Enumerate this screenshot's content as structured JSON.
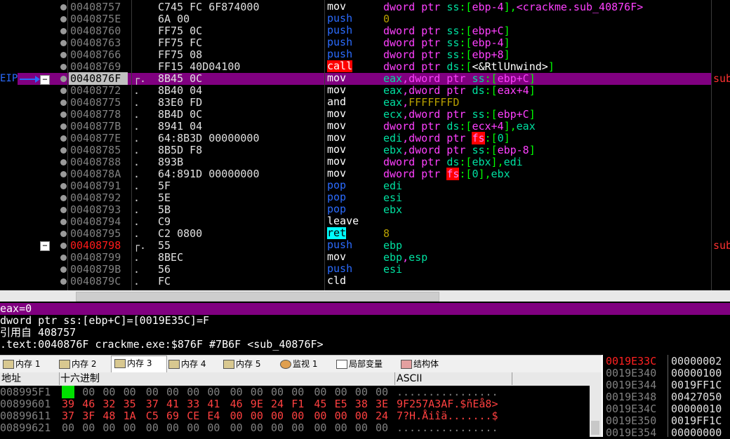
{
  "disassembly": {
    "eip_label": "EIP",
    "fold_symbol": "−",
    "rows": [
      {
        "addr": "00408757",
        "bracket": "",
        "bytes": "C745 FC 6F874000",
        "mnem": "mov",
        "mnem_style": "mov",
        "ops": [
          [
            "dword ptr ",
            "mag"
          ],
          [
            "ss",
            "gr"
          ],
          [
            ":[",
            "lime"
          ],
          [
            "ebp-4",
            "mag"
          ],
          [
            "],",
            "lime"
          ],
          [
            "<crackme.sub_40876F>",
            "mag"
          ]
        ],
        "cmt": ""
      },
      {
        "addr": "0040875E",
        "bracket": "",
        "bytes": "6A 00",
        "mnem": "push",
        "mnem_style": "push",
        "ops": [
          [
            "0",
            "gold"
          ]
        ],
        "cmt": ""
      },
      {
        "addr": "00408760",
        "bracket": "",
        "bytes": "FF75 0C",
        "mnem": "push",
        "mnem_style": "push",
        "ops": [
          [
            "dword ptr ",
            "mag"
          ],
          [
            "ss",
            "gr"
          ],
          [
            ":[",
            "lime"
          ],
          [
            "ebp+C",
            "mag"
          ],
          [
            "]",
            "lime"
          ]
        ],
        "cmt": ""
      },
      {
        "addr": "00408763",
        "bracket": "",
        "bytes": "FF75 FC",
        "mnem": "push",
        "mnem_style": "push",
        "ops": [
          [
            "dword ptr ",
            "mag"
          ],
          [
            "ss",
            "gr"
          ],
          [
            ":[",
            "lime"
          ],
          [
            "ebp-4",
            "mag"
          ],
          [
            "]",
            "lime"
          ]
        ],
        "cmt": ""
      },
      {
        "addr": "00408766",
        "bracket": "",
        "bytes": "FF75 08",
        "mnem": "push",
        "mnem_style": "push",
        "ops": [
          [
            "dword ptr ",
            "mag"
          ],
          [
            "ss",
            "gr"
          ],
          [
            ":[",
            "lime"
          ],
          [
            "ebp+8",
            "mag"
          ],
          [
            "]",
            "lime"
          ]
        ],
        "cmt": ""
      },
      {
        "addr": "00408769",
        "bracket": "",
        "bytes": "FF15 40D04100",
        "mnem": "call",
        "mnem_style": "call",
        "ops": [
          [
            "dword ptr ",
            "mag"
          ],
          [
            "ds",
            "gr"
          ],
          [
            ":[",
            "lime"
          ],
          [
            "<&RtlUnwind>",
            "white"
          ],
          [
            "]",
            "lime"
          ]
        ],
        "cmt": ""
      },
      {
        "addr": "0040876F",
        "bracket": "┌.",
        "bytes": "8B45 0C",
        "mnem": "mov",
        "mnem_style": "mov",
        "ops": [
          [
            "eax",
            "gr"
          ],
          [
            ",",
            "mag"
          ],
          [
            "dword ptr ",
            "mag"
          ],
          [
            "ss",
            "gr"
          ],
          [
            ":[",
            "lime"
          ],
          [
            "ebp+C",
            "mag"
          ],
          [
            "]",
            "lime"
          ]
        ],
        "cmt": "sub",
        "sel": true,
        "eip": true
      },
      {
        "addr": "00408772",
        "bracket": ".",
        "bytes": "8B40 04",
        "mnem": "mov",
        "mnem_style": "mov",
        "ops": [
          [
            "eax",
            "gr"
          ],
          [
            ",",
            "mag"
          ],
          [
            "dword ptr ",
            "mag"
          ],
          [
            "ds",
            "gr"
          ],
          [
            ":[",
            "lime"
          ],
          [
            "eax+4",
            "mag"
          ],
          [
            "]",
            "lime"
          ]
        ],
        "cmt": ""
      },
      {
        "addr": "00408775",
        "bracket": ".",
        "bytes": "83E0 FD",
        "mnem": "and",
        "mnem_style": "mov",
        "ops": [
          [
            "eax",
            "gr"
          ],
          [
            ",",
            "mag"
          ],
          [
            "FFFFFFFD",
            "gold"
          ]
        ],
        "cmt": ""
      },
      {
        "addr": "00408778",
        "bracket": ".",
        "bytes": "8B4D 0C",
        "mnem": "mov",
        "mnem_style": "mov",
        "ops": [
          [
            "ecx",
            "gr"
          ],
          [
            ",",
            "mag"
          ],
          [
            "dword ptr ",
            "mag"
          ],
          [
            "ss",
            "gr"
          ],
          [
            ":[",
            "lime"
          ],
          [
            "ebp+C",
            "mag"
          ],
          [
            "]",
            "lime"
          ]
        ],
        "cmt": ""
      },
      {
        "addr": "0040877B",
        "bracket": ".",
        "bytes": "8941 04",
        "mnem": "mov",
        "mnem_style": "mov",
        "ops": [
          [
            "dword ptr ",
            "mag"
          ],
          [
            "ds",
            "gr"
          ],
          [
            ":[",
            "lime"
          ],
          [
            "ecx+4",
            "mag"
          ],
          [
            "],",
            "lime"
          ],
          [
            "eax",
            "gr"
          ]
        ],
        "cmt": ""
      },
      {
        "addr": "0040877E",
        "bracket": ".",
        "bytes": "64:8B3D 00000000",
        "mnem": "mov",
        "mnem_style": "mov",
        "ops": [
          [
            "edi",
            "gr"
          ],
          [
            ",",
            "mag"
          ],
          [
            "dword ptr ",
            "mag"
          ],
          [
            "fs",
            "fs"
          ],
          [
            ":[",
            "lime"
          ],
          [
            "0",
            "gr"
          ],
          [
            "]",
            "lime"
          ]
        ],
        "cmt": ""
      },
      {
        "addr": "00408785",
        "bracket": ".",
        "bytes": "8B5D F8",
        "mnem": "mov",
        "mnem_style": "mov",
        "ops": [
          [
            "ebx",
            "gr"
          ],
          [
            ",",
            "mag"
          ],
          [
            "dword ptr ",
            "mag"
          ],
          [
            "ss",
            "gr"
          ],
          [
            ":[",
            "lime"
          ],
          [
            "ebp-8",
            "mag"
          ],
          [
            "]",
            "lime"
          ]
        ],
        "cmt": ""
      },
      {
        "addr": "00408788",
        "bracket": ".",
        "bytes": "893B",
        "mnem": "mov",
        "mnem_style": "mov",
        "ops": [
          [
            "dword ptr ",
            "mag"
          ],
          [
            "ds",
            "gr"
          ],
          [
            ":[",
            "lime"
          ],
          [
            "ebx",
            "gr"
          ],
          [
            "],",
            "lime"
          ],
          [
            "edi",
            "gr"
          ]
        ],
        "cmt": ""
      },
      {
        "addr": "0040878A",
        "bracket": ".",
        "bytes": "64:891D 00000000",
        "mnem": "mov",
        "mnem_style": "mov",
        "ops": [
          [
            "dword ptr ",
            "mag"
          ],
          [
            "fs",
            "fs"
          ],
          [
            ":[",
            "lime"
          ],
          [
            "0",
            "gr"
          ],
          [
            "],",
            "lime"
          ],
          [
            "ebx",
            "gr"
          ]
        ],
        "cmt": ""
      },
      {
        "addr": "00408791",
        "bracket": ".",
        "bytes": "5F",
        "mnem": "pop",
        "mnem_style": "push",
        "ops": [
          [
            "edi",
            "gr"
          ]
        ],
        "cmt": ""
      },
      {
        "addr": "00408792",
        "bracket": ".",
        "bytes": "5E",
        "mnem": "pop",
        "mnem_style": "push",
        "ops": [
          [
            "esi",
            "gr"
          ]
        ],
        "cmt": ""
      },
      {
        "addr": "00408793",
        "bracket": ".",
        "bytes": "5B",
        "mnem": "pop",
        "mnem_style": "push",
        "ops": [
          [
            "ebx",
            "gr"
          ]
        ],
        "cmt": ""
      },
      {
        "addr": "00408794",
        "bracket": ".",
        "bytes": "C9",
        "mnem": "leave",
        "mnem_style": "mov",
        "ops": [],
        "cmt": ""
      },
      {
        "addr": "00408795",
        "bracket": ".",
        "bytes": "C2 0800",
        "mnem": "ret",
        "mnem_style": "ret",
        "ops": [
          [
            "8",
            "gold"
          ]
        ],
        "cmt": ""
      },
      {
        "addr": "00408798",
        "bracket": "┌.",
        "bytes": "55",
        "mnem": "push",
        "mnem_style": "push",
        "ops": [
          [
            "ebp",
            "gr"
          ]
        ],
        "cmt": "sub",
        "redaddr": true,
        "fold": true
      },
      {
        "addr": "00408799",
        "bracket": ".",
        "bytes": "8BEC",
        "mnem": "mov",
        "mnem_style": "mov",
        "ops": [
          [
            "ebp",
            "gr"
          ],
          [
            ",",
            "mag"
          ],
          [
            "esp",
            "gr"
          ]
        ],
        "cmt": ""
      },
      {
        "addr": "0040879B",
        "bracket": ".",
        "bytes": "56",
        "mnem": "push",
        "mnem_style": "push",
        "ops": [
          [
            "esi",
            "gr"
          ]
        ],
        "cmt": ""
      },
      {
        "addr": "0040879C",
        "bracket": ".",
        "bytes": "FC",
        "mnem": "cld",
        "mnem_style": "mov",
        "ops": [],
        "cmt": ""
      }
    ]
  },
  "info": {
    "header": "eax=0",
    "lines": [
      "dword ptr ss:[ebp+C]=[0019E35C]=F",
      "引用自 408757",
      ".text:0040876F crackme.exe:$876F #7B6F <sub_40876F>"
    ]
  },
  "tabs": [
    {
      "label": "内存 1",
      "icon": "memory-icon",
      "active": false
    },
    {
      "label": "内存 2",
      "icon": "memory-icon",
      "active": false
    },
    {
      "label": "内存 3",
      "icon": "memory-icon",
      "active": true
    },
    {
      "label": "内存 4",
      "icon": "memory-icon",
      "active": false
    },
    {
      "label": "内存 5",
      "icon": "memory-icon",
      "active": false
    },
    {
      "label": "监视 1",
      "icon": "watch-icon",
      "active": false
    },
    {
      "label": "局部变量",
      "icon": "locals-icon",
      "active": false
    },
    {
      "label": "结构体",
      "icon": "struct-icon",
      "active": false
    }
  ],
  "dump": {
    "col_address": "地址",
    "col_hex": "十六进制",
    "col_ascii": "ASCII",
    "rows": [
      {
        "addr": "008995F1",
        "hex": [
          "00",
          "00",
          "00",
          "00",
          "00",
          "00",
          "00",
          "00",
          "00",
          "00",
          "00",
          "00",
          "00",
          "00",
          "00",
          "00"
        ],
        "ascii": "................",
        "red": false,
        "first_hl": true
      },
      {
        "addr": "00899601",
        "hex": [
          "39",
          "46",
          "32",
          "35",
          "37",
          "41",
          "33",
          "41",
          "46",
          "9E",
          "24",
          "F1",
          "45",
          "E5",
          "38",
          "3E"
        ],
        "ascii": "9F257A3AF.$ñEå8>",
        "red": true
      },
      {
        "addr": "00899611",
        "hex": [
          "37",
          "3F",
          "48",
          "1A",
          "C5",
          "69",
          "CE",
          "E4",
          "00",
          "00",
          "00",
          "00",
          "00",
          "00",
          "00",
          "24"
        ],
        "ascii": "7?H.Åiîä.......$",
        "red": true
      },
      {
        "addr": "00899621",
        "hex": [
          "00",
          "00",
          "00",
          "00",
          "00",
          "00",
          "00",
          "00",
          "00",
          "00",
          "00",
          "00",
          "00",
          "00",
          "00",
          "00"
        ],
        "ascii": "................",
        "red": false
      }
    ]
  },
  "stack": [
    {
      "addr": "0019E33C",
      "val": "00000002",
      "current": true
    },
    {
      "addr": "0019E340",
      "val": "00000100"
    },
    {
      "addr": "0019E344",
      "val": "0019FF1C"
    },
    {
      "addr": "0019E348",
      "val": "00427050"
    },
    {
      "addr": "0019E34C",
      "val": "00000010"
    },
    {
      "addr": "0019E350",
      "val": "0019FF1C"
    },
    {
      "addr": "0019E354",
      "val": "00000000"
    }
  ],
  "colors": {
    "selection": "#800080",
    "mag": "#ff40ff",
    "gr": "#00e0a0",
    "lime": "#00ff00",
    "gold": "#b8a000",
    "push_bg": "#0000ff",
    "call_bg": "#ff0000",
    "ret_bg": "#00ffff"
  }
}
